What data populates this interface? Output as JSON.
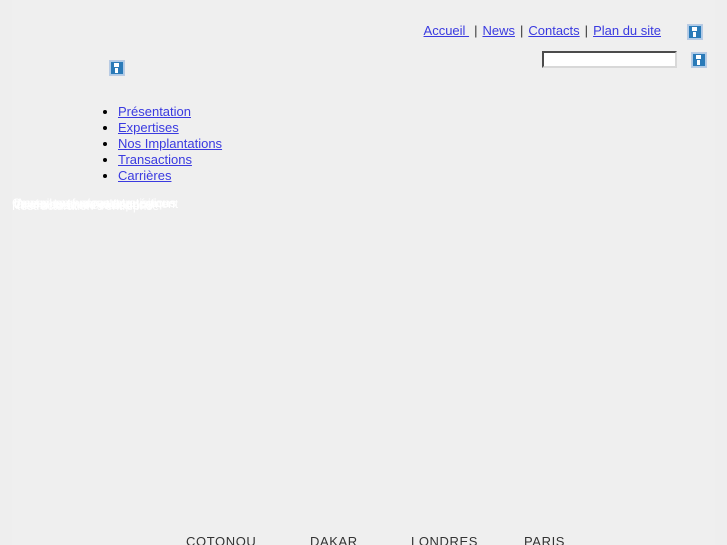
{
  "topnav": {
    "links": [
      {
        "label": "Accueil "
      },
      {
        "label": "News"
      },
      {
        "label": "Contacts"
      },
      {
        "label": "Plan du site"
      }
    ],
    "separator": "|",
    "corner_image": "broken-image-icon"
  },
  "logo": {
    "alt": "broken-image-icon"
  },
  "search": {
    "value": "",
    "placeholder": "",
    "button_icon": "broken-image-icon"
  },
  "mainmenu": {
    "items": [
      {
        "label": "Présentation"
      },
      {
        "label": "Expertises"
      },
      {
        "label": "Nos Implantations"
      },
      {
        "label": "Transactions"
      },
      {
        "label": "Carrières"
      }
    ]
  },
  "slogan": {
    "lines": [
      "Conseil en fusions acquisitions",
      "Levée de fonds et financement",
      "Valorisation et évaluation",
      "Accompagnement stratégique",
      "Restructuration d'entreprise",
      "Transmission d'entreprise"
    ]
  },
  "footer": {
    "cities": [
      {
        "name": "COTONOU"
      },
      {
        "name": "DAKAR"
      },
      {
        "name": "LONDRES"
      },
      {
        "name": "PARIS"
      }
    ]
  },
  "colors": {
    "page_background": "#eeeeee",
    "content_background": "#efefef",
    "link": "#3a3ae0",
    "city_text": "#333333",
    "slogan_text": "#ffffff",
    "placeholder_icon": "#2a7ab8"
  }
}
